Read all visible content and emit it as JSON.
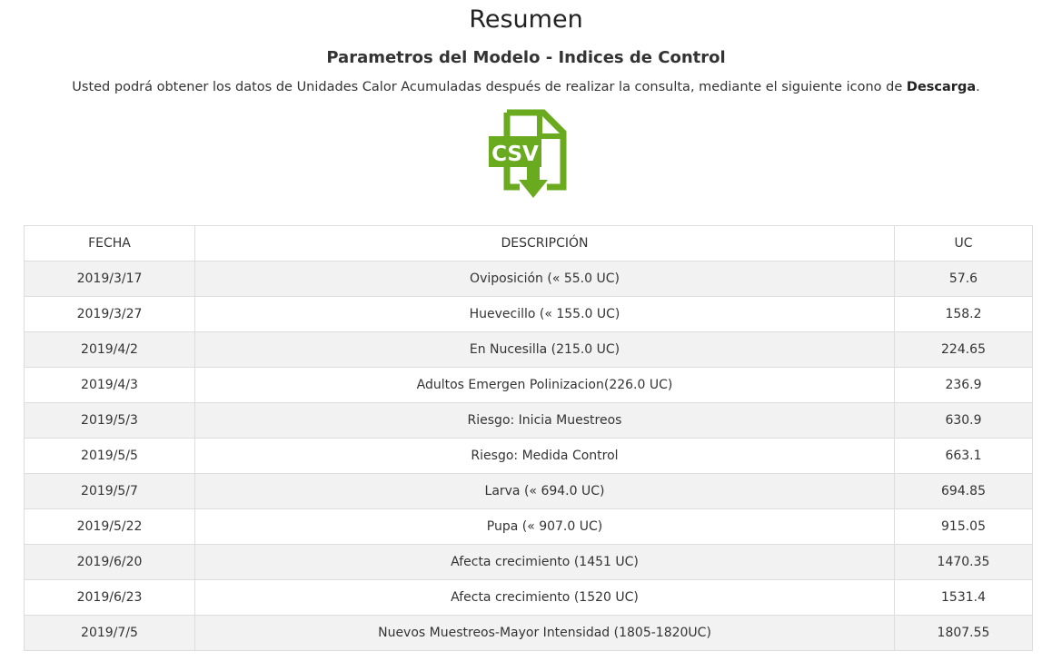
{
  "header": {
    "title": "Resumen",
    "subtitle": "Parametros del Modelo - Indices de Control",
    "note_prefix": "Usted podrá obtener los datos de Unidades Calor Acumuladas después de realizar la consulta, mediante el siguiente icono de ",
    "note_bold": "Descarga",
    "note_suffix": "."
  },
  "download": {
    "icon": "csv-file-download-icon",
    "label": "CSV",
    "color": "#6aaa1f"
  },
  "table": {
    "columns": [
      "FECHA",
      "DESCRIPCIÓN",
      "UC"
    ],
    "rows": [
      {
        "fecha": "2019/3/17",
        "descripcion": "Oviposición (« 55.0 UC)",
        "uc": "57.6"
      },
      {
        "fecha": "2019/3/27",
        "descripcion": "Huevecillo (« 155.0 UC)",
        "uc": "158.2"
      },
      {
        "fecha": "2019/4/2",
        "descripcion": "En Nucesilla (215.0 UC)",
        "uc": "224.65"
      },
      {
        "fecha": "2019/4/3",
        "descripcion": "Adultos Emergen Polinizacion(226.0 UC)",
        "uc": "236.9"
      },
      {
        "fecha": "2019/5/3",
        "descripcion": "Riesgo: Inicia Muestreos",
        "uc": "630.9"
      },
      {
        "fecha": "2019/5/5",
        "descripcion": "Riesgo: Medida Control",
        "uc": "663.1"
      },
      {
        "fecha": "2019/5/7",
        "descripcion": "Larva (« 694.0 UC)",
        "uc": "694.85"
      },
      {
        "fecha": "2019/5/22",
        "descripcion": "Pupa (« 907.0 UC)",
        "uc": "915.05"
      },
      {
        "fecha": "2019/6/20",
        "descripcion": "Afecta crecimiento (1451 UC)",
        "uc": "1470.35"
      },
      {
        "fecha": "2019/6/23",
        "descripcion": "Afecta crecimiento (1520 UC)",
        "uc": "1531.4"
      },
      {
        "fecha": "2019/7/5",
        "descripcion": "Nuevos Muestreos-Mayor Intensidad (1805-1820UC)",
        "uc": "1807.55"
      }
    ]
  }
}
